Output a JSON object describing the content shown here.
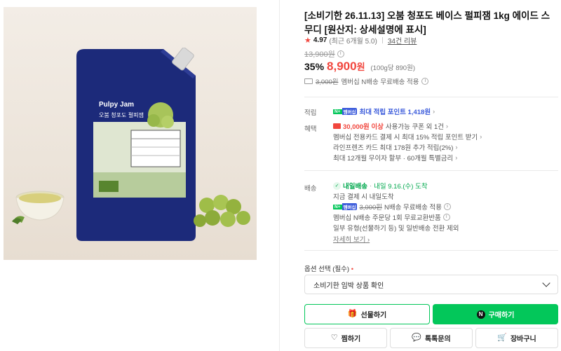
{
  "product": {
    "title": "[소비기한 26.11.13] 오붐 청포도 베이스 펄피잼 1kg 에이드 스무디 [원산지: 상세설명에 표시]",
    "package_brand": "Pulpy Jam",
    "package_name": "오붐 청포도 펄피잼"
  },
  "rating": {
    "score": "4.97",
    "recent": "(최근 6개월 5.0",
    "review_count": "34건 리뷰"
  },
  "price": {
    "original": "13,900원",
    "discount": "35%",
    "sale_number": "8,900",
    "sale_unit": "원",
    "unit_price": "(100g당 890원)"
  },
  "shipping_summary": {
    "strike": "3,000원",
    "text": "멤버십 N배송 무료배송 적용"
  },
  "benefits": {
    "points_label": "적립",
    "points_badge": "N+ 멤버십",
    "points_text": "최대 적립 포인트 1,418원",
    "perks_label": "혜택",
    "coupon_amount": "30,000원 이상",
    "coupon_text": "사용가능 쿠폰 외 1건",
    "card_line": "멤버십 전용카드 결제 시 최대 15% 적립 포인트 받기",
    "line_card": "라인프렌즈 카드 최대 178원 추가 적립(2%)",
    "installment": "최대 12개월 무이자 할부 · 60개월 특별금리"
  },
  "delivery": {
    "label": "배송",
    "badge": "내일배송",
    "arrive": "내일 9.16.(수) 도착",
    "order_now": "지금 결제 시 내일도착",
    "npay_strike": "3,000원",
    "npay_text": "N배송 무료배송 적용",
    "membership": "멤버십 N배송 주문당 1회 무료교환반품",
    "exception": "일부 유형(선물하기 등) 및 일반배송 전환 제외",
    "detail": "자세히 보기"
  },
  "options": {
    "label": "옵션 선택 (필수)",
    "required_mark": "•",
    "selected": "소비기한 임박 상품 확인"
  },
  "buttons": {
    "gift": "선물하기",
    "buy": "구매하기",
    "wish": "찜하기",
    "talk": "톡톡문의",
    "cart": "장바구니"
  },
  "colors": {
    "accent_green": "#03c75a",
    "price_red": "#f1463d",
    "membership_blue": "#3b5bdb"
  }
}
